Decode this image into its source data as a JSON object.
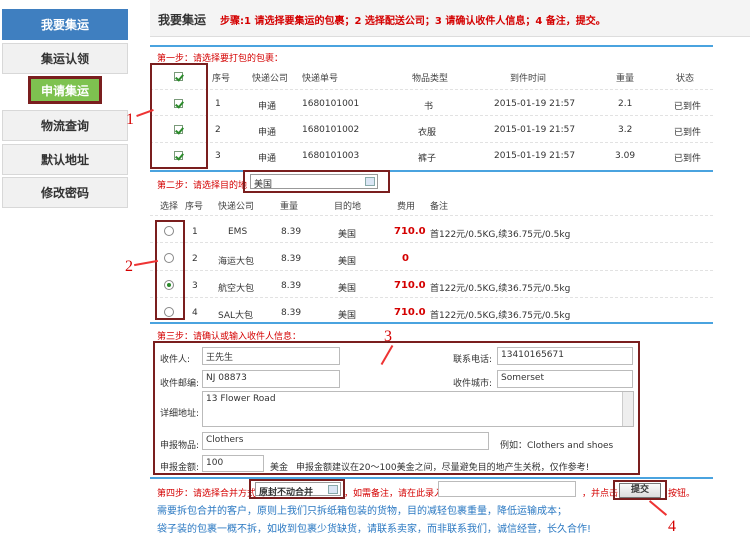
{
  "sidebar": {
    "header": "我要集运",
    "items": [
      "集运认领",
      "申请集运",
      "物流查询",
      "默认地址",
      "修改密码"
    ]
  },
  "header": {
    "title": "我要集运",
    "steps": "步骤:1 请选择要集运的包裹；2 选择配送公司；3 请确认收件人信息；4 备注，提交。"
  },
  "step1": {
    "label": "第一步：请选择要打包的包裹：",
    "columns": [
      "序号",
      "快递公司",
      "快递单号",
      "物品类型",
      "到件时间",
      "重量",
      "状态"
    ],
    "rows": [
      {
        "no": "1",
        "company": "申通",
        "tracking": "1680101001",
        "type": "书",
        "time": "2015-01-19 21:57",
        "weight": "2.1",
        "status": "已到件"
      },
      {
        "no": "2",
        "company": "申通",
        "tracking": "1680101002",
        "type": "衣服",
        "time": "2015-01-19 21:57",
        "weight": "3.2",
        "status": "已到件"
      },
      {
        "no": "3",
        "company": "申通",
        "tracking": "1680101003",
        "type": "裤子",
        "time": "2015-01-19 21:57",
        "weight": "3.09",
        "status": "已到件"
      }
    ]
  },
  "step2": {
    "label": "第二步：请选择目的地",
    "destination": "美国",
    "columns": [
      "选择",
      "序号",
      "快递公司",
      "重量",
      "目的地",
      "费用",
      "备注"
    ],
    "rows": [
      {
        "no": "1",
        "company": "EMS",
        "weight": "8.39",
        "dest": "美国",
        "fee": "710.0",
        "note": "首122元/0.5KG,续36.75元/0.5kg",
        "selected": false
      },
      {
        "no": "2",
        "company": "海运大包",
        "weight": "8.39",
        "dest": "美国",
        "fee": "0",
        "note": "",
        "selected": false
      },
      {
        "no": "3",
        "company": "航空大包",
        "weight": "8.39",
        "dest": "美国",
        "fee": "710.0",
        "note": "首122元/0.5KG,续36.75元/0.5kg",
        "selected": true
      },
      {
        "no": "4",
        "company": "SAL大包",
        "weight": "8.39",
        "dest": "美国",
        "fee": "710.0",
        "note": "首122元/0.5KG,续36.75元/0.5kg",
        "selected": false
      }
    ]
  },
  "step3": {
    "label": "第三步：请确认或输入收件人信息：",
    "recipient_label": "收件人:",
    "recipient": "王先生",
    "phone_label": "联系电话:",
    "phone": "13410165671",
    "zip_label": "收件邮编:",
    "zip": "NJ 08873",
    "city_label": "收件城市:",
    "city": "Somerset",
    "address_label": "详细地址:",
    "address": "13 Flower Road",
    "goods_label": "申报物品:",
    "goods": "Clothers",
    "goods_example": "例如：Clothers and shoes",
    "amount_label": "申报金额:",
    "amount": "100",
    "amount_unit": "美金",
    "amount_note": "申报金额建议在20～100美金之间，尽量避免目的地产生关税，仅作参考!"
  },
  "step4": {
    "label_a": "第四步：请选择合并方式",
    "merge_option": "原封不动合并",
    "label_b": "，如需备注，请在此录入",
    "label_c": "，并点击",
    "submit": "提交",
    "label_d": "按钮。",
    "info1": "需要拆包合并的客户，原则上我们只拆纸箱包装的货物，目的减轻包裹重量，降低运输成本；",
    "info2": "袋子装的包裹一概不拆，如收到包裹少货缺货，请联系卖家，而非联系我们，诚信经营，长久合作!"
  },
  "annotations": [
    "1",
    "2",
    "3",
    "4"
  ]
}
